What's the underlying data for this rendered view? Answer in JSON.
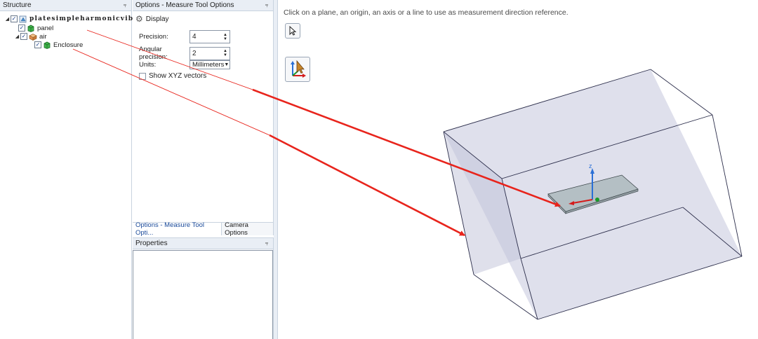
{
  "structure": {
    "title": "Structure",
    "items": [
      {
        "label": "platesimpleharmonicvibrat",
        "level": 0,
        "checked": true,
        "expanded": true
      },
      {
        "label": "panel",
        "level": 1,
        "checked": true
      },
      {
        "label": "air",
        "level": 1,
        "checked": true,
        "expanded": true
      },
      {
        "label": "Enclosure",
        "level": 2,
        "checked": true
      }
    ]
  },
  "options": {
    "title": "Options - Measure Tool Options",
    "section": "Display",
    "precision_label": "Precision:",
    "precision_value": "4",
    "angular_label": "Angular precision:",
    "angular_value": "2",
    "units_label": "Units:",
    "units_value": "Millimeters",
    "show_xyz_label": "Show XYZ vectors",
    "show_xyz_checked": false
  },
  "tabs": [
    {
      "label": "Options - Measure Tool Opti...",
      "active": true
    },
    {
      "label": "Camera Options",
      "active": false
    }
  ],
  "properties": {
    "title": "Properties"
  },
  "viewport": {
    "hint": "Click on a plane, an origin, an axis or a line to use as measurement direction reference.",
    "axis_label": "z",
    "tools": [
      "select-arrow-icon",
      "measure-direction-icon"
    ]
  },
  "colors": {
    "annotation_arrow": "#e8241c",
    "box_fill": "#c9cbdf",
    "box_edge": "#2b2d4a",
    "panel_fill": "#b4bfc4",
    "axis_z": "#2a6fd6",
    "axis_x": "#d41c1c",
    "axis_y": "#1a9a2a"
  }
}
